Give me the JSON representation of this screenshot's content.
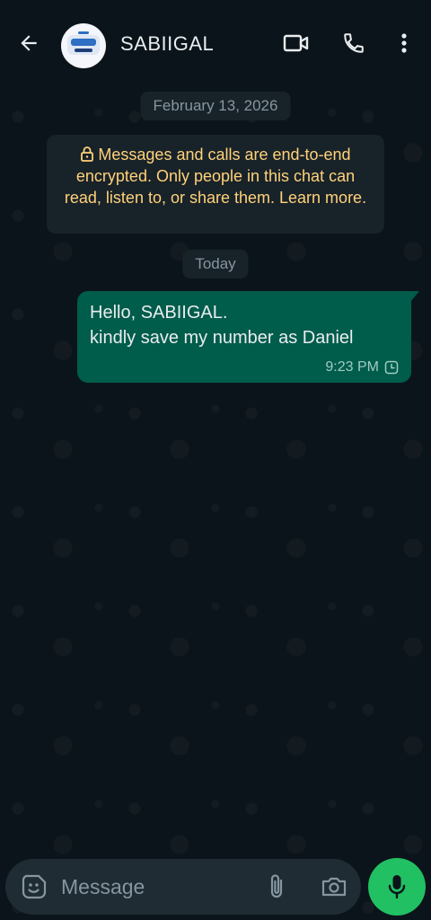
{
  "header": {
    "contact_name": "SABIIGAL",
    "avatar_icon": "group-logo-avatar",
    "actions": [
      "back-arrow-icon",
      "video-call-icon",
      "voice-call-icon",
      "more-options-icon"
    ]
  },
  "chat": {
    "date_divider": "February 13, 2026",
    "encryption_notice": "Messages and calls are end-to-end encrypted. Only people in this chat can read, listen to, or share them. Learn more.",
    "today_divider": "Today",
    "messages": [
      {
        "direction": "outgoing",
        "lines": [
          "Hello, SABIIGAL.",
          "kindly save my number as Daniel"
        ],
        "time": "9:23 PM",
        "status": "pending-clock-icon"
      }
    ]
  },
  "composer": {
    "placeholder": "Message"
  },
  "colors": {
    "background": "#0b141a",
    "outgoing_bubble": "#005c4b",
    "system_pill": "#182229",
    "encryption_text": "#ffd279",
    "mic_button": "#21c063",
    "composer": "#1f2c34"
  }
}
